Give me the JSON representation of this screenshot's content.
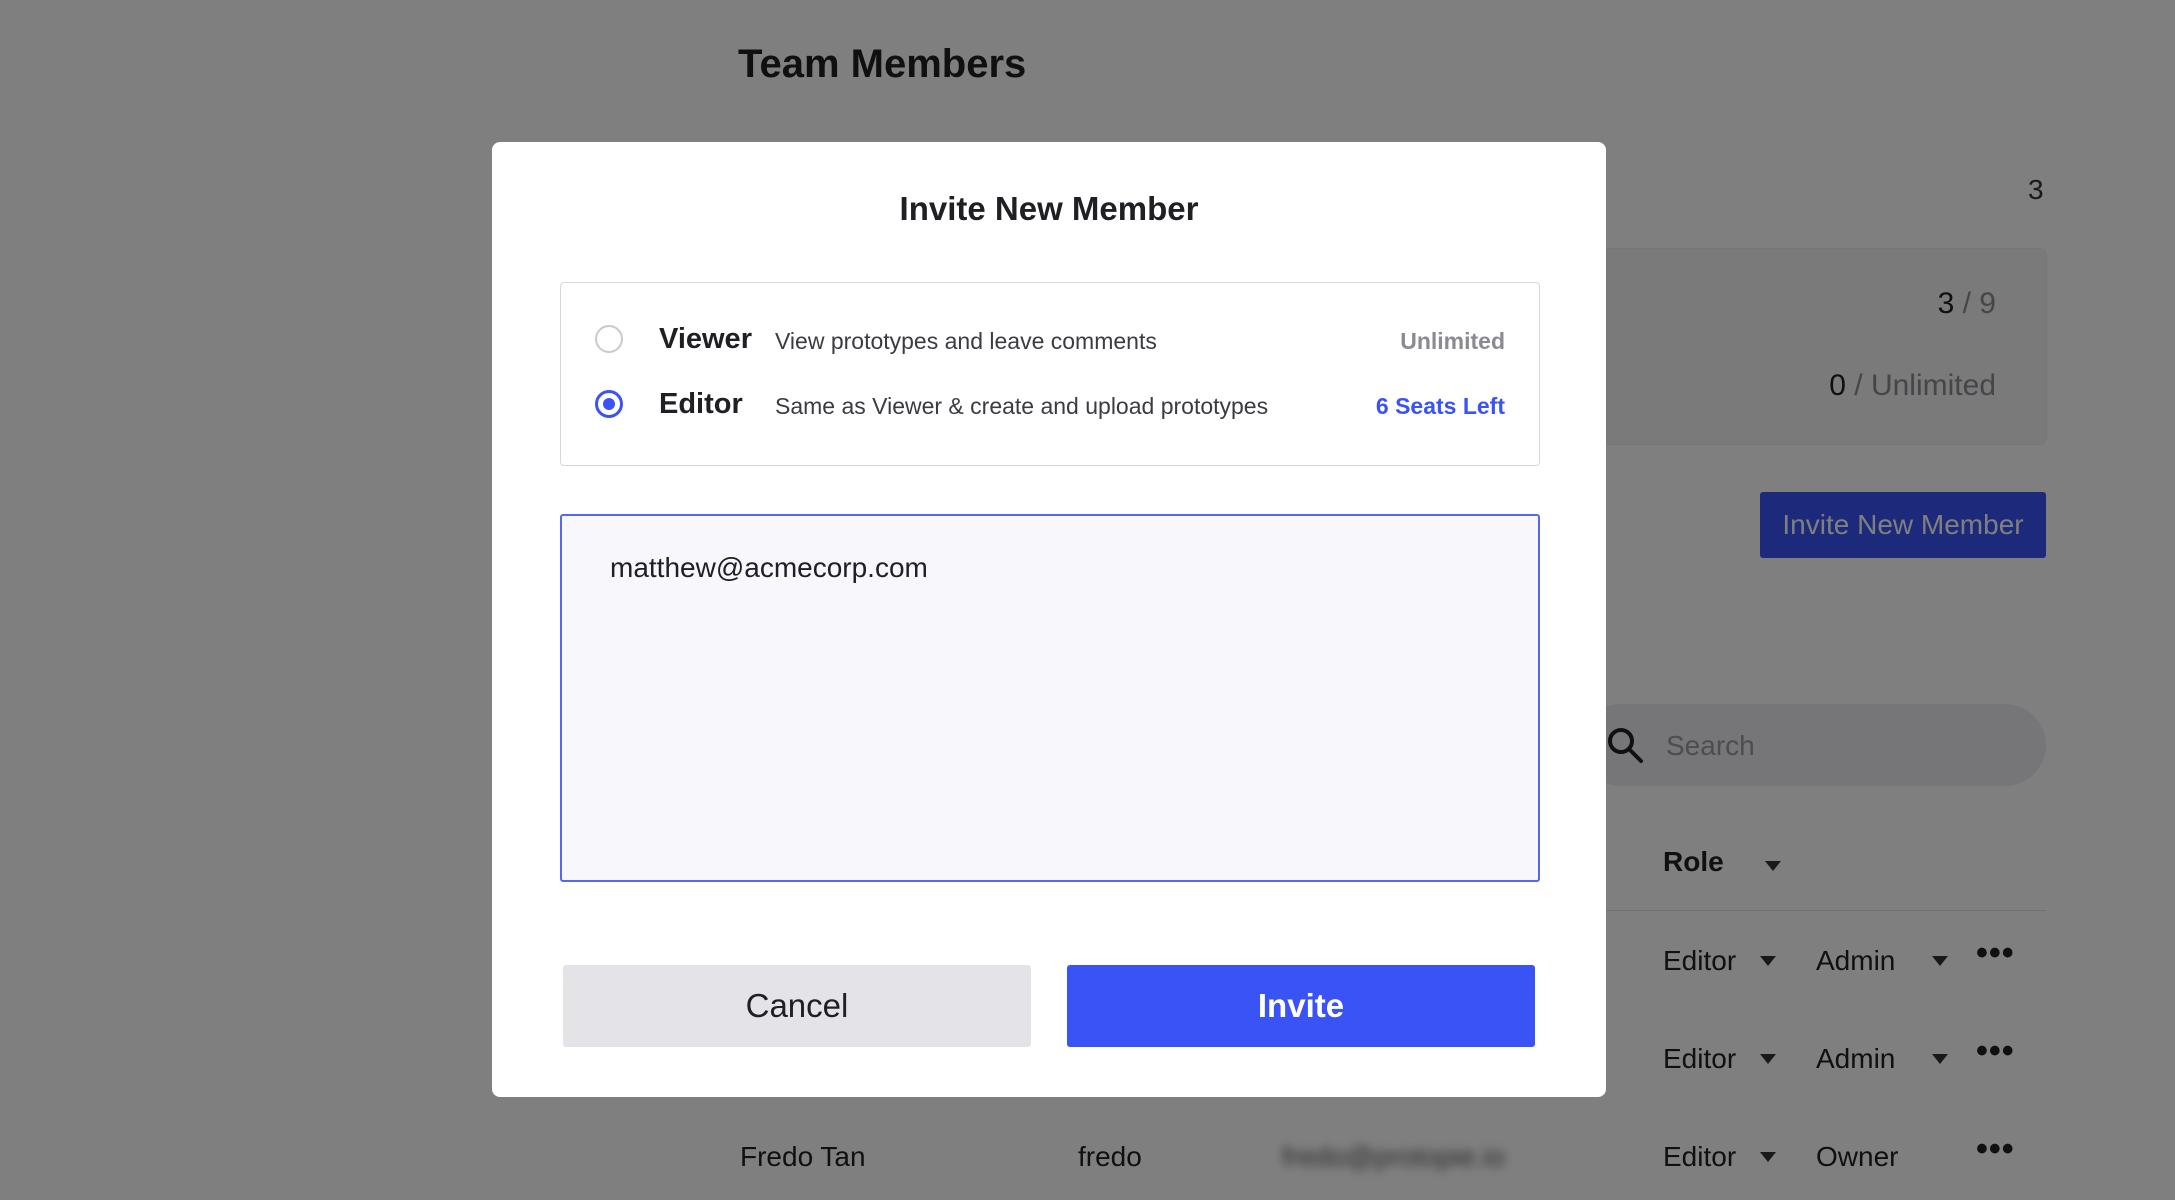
{
  "page": {
    "title": "Team Members",
    "member_count": "3"
  },
  "seats": {
    "editor_used": "3",
    "editor_sep_total": " / 9",
    "viewer_used": "0",
    "viewer_sep_total": " / Unlimited"
  },
  "invite_button_label": "Invite New Member",
  "search": {
    "placeholder": "Search"
  },
  "table": {
    "role_header": "Role",
    "rows": [
      {
        "name": "",
        "username": "",
        "email": "",
        "role": "Editor",
        "permission": "Admin"
      },
      {
        "name": "",
        "username": "",
        "email": "",
        "role": "Editor",
        "permission": "Admin"
      },
      {
        "name": "Fredo Tan",
        "username": "fredo",
        "email": "fredo@protopie.io",
        "role": "Editor",
        "permission": "Owner"
      }
    ],
    "more_label": "•••"
  },
  "modal": {
    "title": "Invite New Member",
    "roles": [
      {
        "name": "Viewer",
        "description": "View prototypes and leave comments",
        "availability": "Unlimited",
        "selected": false,
        "availability_color": "#8a8a94"
      },
      {
        "name": "Editor",
        "description": "Same as Viewer & create and upload prototypes",
        "availability": "6 Seats Left",
        "selected": true,
        "availability_color": "#3a53f5"
      }
    ],
    "emails_value": "matthew@acmecorp.com",
    "cancel_label": "Cancel",
    "invite_label": "Invite"
  },
  "colors": {
    "accent": "#3a53f5",
    "overlay": "rgba(0,0,0,0.5)"
  }
}
